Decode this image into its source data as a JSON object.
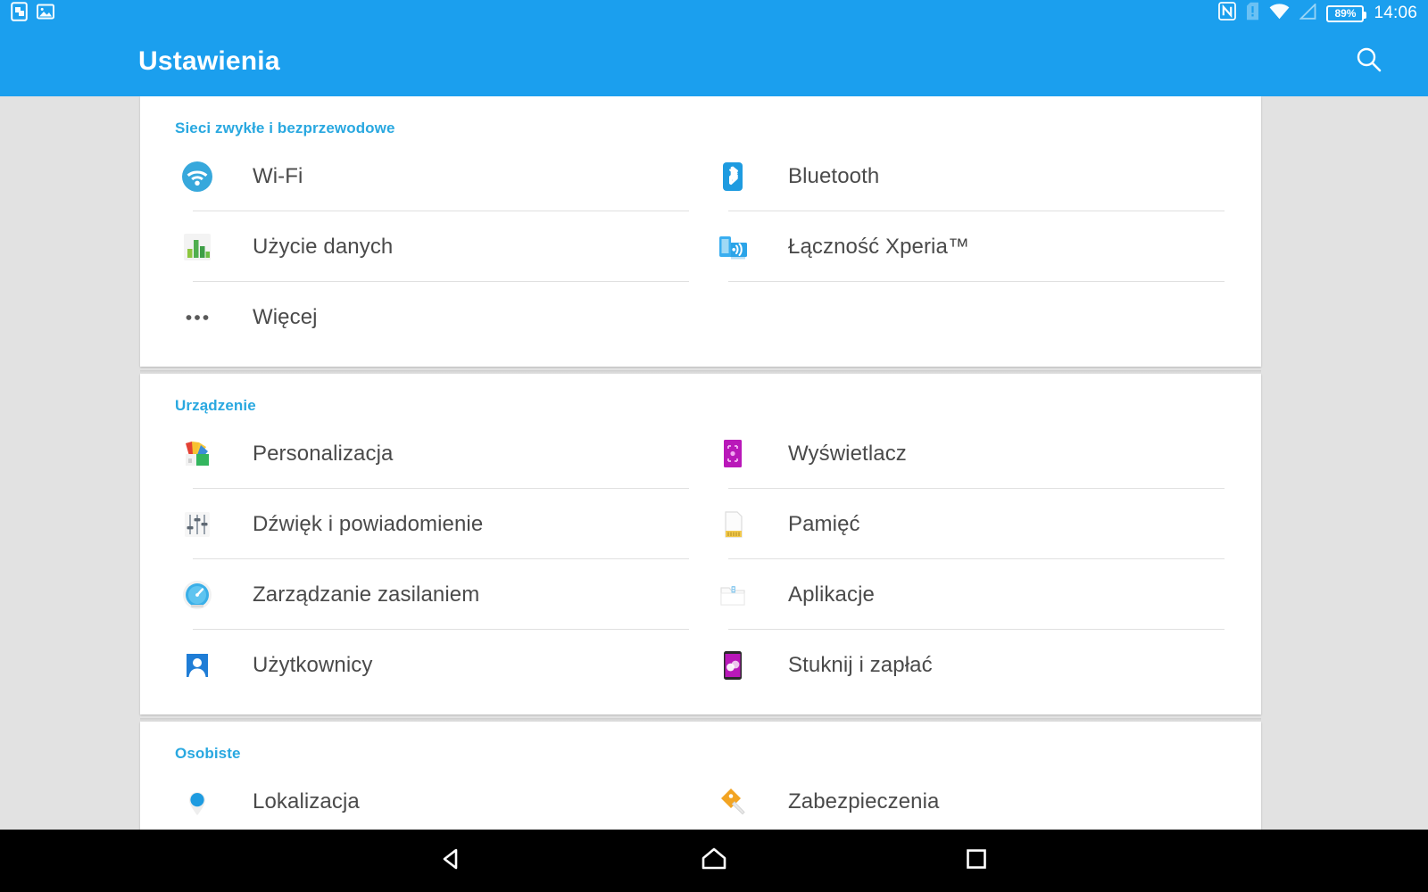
{
  "statusbar": {
    "left_icons": [
      {
        "name": "screen-record-icon",
        "label": "screenshot"
      },
      {
        "name": "image-icon",
        "label": "image"
      }
    ],
    "right_icons": [
      {
        "name": "nfc-icon",
        "label": "NFC"
      },
      {
        "name": "sim-alert-icon",
        "label": "SIM card alert"
      },
      {
        "name": "wifi-icon",
        "label": "Wi-Fi"
      },
      {
        "name": "cellular-signal-icon",
        "label": "No signal"
      }
    ],
    "battery_percent": "89%",
    "clock": "14:06"
  },
  "appbar": {
    "title": "Ustawienia",
    "search_icon": "search-icon"
  },
  "colors": {
    "accent": "#1B9FEE",
    "section_header": "#29A8E0",
    "card_bg": "#ffffff",
    "page_bg": "#e2e2e2",
    "label_text": "#4a4a4a"
  },
  "sections": [
    {
      "id": "wireless",
      "header": "Sieci zwykłe i bezprzewodowe",
      "items": [
        {
          "label": "Wi-Fi",
          "icon": "wifi-settings-icon"
        },
        {
          "label": "Bluetooth",
          "icon": "bluetooth-icon"
        },
        {
          "label": "Użycie danych",
          "icon": "data-usage-icon"
        },
        {
          "label": "Łączność Xperia™",
          "icon": "xperia-connectivity-icon"
        },
        {
          "label": "Więcej",
          "icon": "more-dots-icon"
        }
      ]
    },
    {
      "id": "device",
      "header": "Urządzenie",
      "items": [
        {
          "label": "Personalizacja",
          "icon": "personalization-icon"
        },
        {
          "label": "Wyświetlacz",
          "icon": "display-icon"
        },
        {
          "label": "Dźwięk i powiadomienie",
          "icon": "sound-notification-icon"
        },
        {
          "label": "Pamięć",
          "icon": "storage-icon"
        },
        {
          "label": "Zarządzanie zasilaniem",
          "icon": "power-management-icon"
        },
        {
          "label": "Aplikacje",
          "icon": "apps-icon"
        },
        {
          "label": "Użytkownicy",
          "icon": "users-icon"
        },
        {
          "label": "Stuknij i zapłać",
          "icon": "tap-and-pay-icon"
        }
      ]
    },
    {
      "id": "personal",
      "header": "Osobiste",
      "items": [
        {
          "label": "Lokalizacja",
          "icon": "location-icon"
        },
        {
          "label": "Zabezpieczenia",
          "icon": "security-key-icon"
        }
      ]
    }
  ],
  "navbar": {
    "back": "back-nav-icon",
    "home": "home-nav-icon",
    "recents": "recents-nav-icon"
  }
}
